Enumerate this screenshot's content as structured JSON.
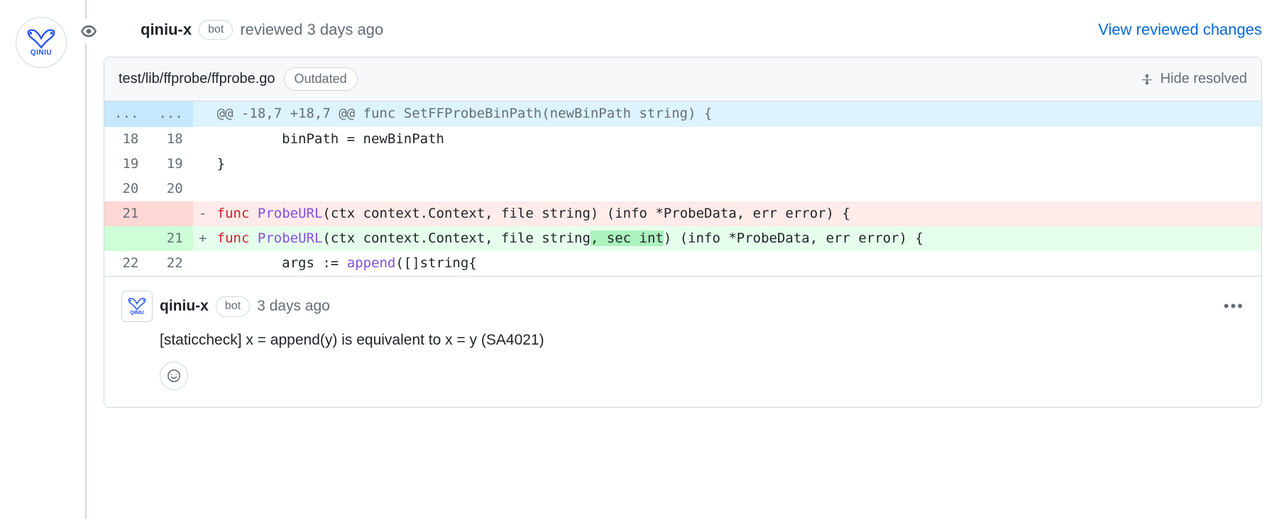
{
  "review": {
    "author": "qiniu-x",
    "bot_label": "bot",
    "action_prefix": "reviewed ",
    "time": "3 days ago",
    "view_changes": "View reviewed changes"
  },
  "file": {
    "path": "test/lib/ffprobe/ffprobe.go",
    "outdated_label": "Outdated",
    "hide_resolved": "Hide resolved"
  },
  "diff": {
    "hunk": "@@ -18,7 +18,7 @@ func SetFFProbeBinPath(newBinPath string) {",
    "ellipsis": "...",
    "lines": [
      {
        "ol": "18",
        "nl": "18",
        "mk": " ",
        "type": "ctx",
        "segs": [
          {
            "t": "        binPath = newBinPath"
          }
        ]
      },
      {
        "ol": "19",
        "nl": "19",
        "mk": " ",
        "type": "ctx",
        "segs": [
          {
            "t": "}"
          }
        ]
      },
      {
        "ol": "20",
        "nl": "20",
        "mk": " ",
        "type": "ctx",
        "segs": [
          {
            "t": ""
          }
        ]
      },
      {
        "ol": "21",
        "nl": "",
        "mk": "-",
        "type": "del",
        "segs": [
          {
            "t": "func",
            "c": "tok-kw"
          },
          {
            "t": " "
          },
          {
            "t": "ProbeURL",
            "c": "tok-fn"
          },
          {
            "t": "(ctx context.Context, file string) (info *ProbeData, err error) {"
          }
        ]
      },
      {
        "ol": "",
        "nl": "21",
        "mk": "+",
        "type": "add",
        "segs": [
          {
            "t": "func",
            "c": "tok-kw"
          },
          {
            "t": " "
          },
          {
            "t": "ProbeURL",
            "c": "tok-fn"
          },
          {
            "t": "(ctx context.Context, file string"
          },
          {
            "t": ", sec int",
            "c": "tok-hl"
          },
          {
            "t": ") (info *ProbeData, err error) {"
          }
        ]
      },
      {
        "ol": "22",
        "nl": "22",
        "mk": " ",
        "type": "ctx",
        "segs": [
          {
            "t": "        args := "
          },
          {
            "t": "append",
            "c": "tok-fn"
          },
          {
            "t": "([]string{"
          }
        ]
      }
    ]
  },
  "comment": {
    "author": "qiniu-x",
    "bot_label": "bot",
    "time": "3 days ago",
    "body": "[staticcheck] x = append(y) is equivalent to x = y (SA4021)"
  },
  "avatar": {
    "label": "QINIU"
  }
}
